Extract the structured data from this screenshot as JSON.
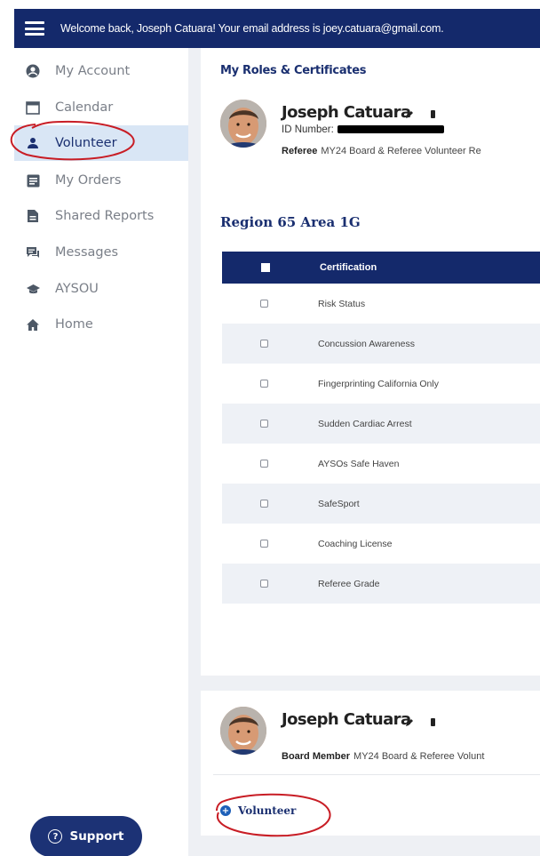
{
  "header": {
    "welcome_text": "Welcome back, Joseph Catuara! Your email address is joey.catuara@gmail.com."
  },
  "sidebar": {
    "items": [
      {
        "label": "My Account",
        "icon": "user-circle-icon"
      },
      {
        "label": "Calendar",
        "icon": "calendar-icon"
      },
      {
        "label": "Volunteer",
        "icon": "person-icon",
        "active": true
      },
      {
        "label": "My Orders",
        "icon": "orders-icon"
      },
      {
        "label": "Shared Reports",
        "icon": "report-icon"
      },
      {
        "label": "Messages",
        "icon": "messages-icon"
      },
      {
        "label": "AYSOU",
        "icon": "graduation-cap-icon"
      },
      {
        "label": "Home",
        "icon": "home-icon"
      }
    ],
    "support_label": "Support"
  },
  "main": {
    "section_title": "My Roles & Certificates",
    "profile1": {
      "name": "Joseph Catuara",
      "id_label": "ID Number:",
      "role": "Referee",
      "role_desc": "MY24 Board & Referee Volunteer Re"
    },
    "region_title": "Region 65 Area 1G",
    "table": {
      "header": "Certification",
      "rows": [
        "Risk Status",
        "Concussion Awareness",
        "Fingerprinting California Only",
        "Sudden Cardiac Arrest",
        "AYSOs Safe Haven",
        "SafeSport",
        "Coaching License",
        "Referee Grade"
      ]
    },
    "profile2": {
      "name": "Joseph Catuara",
      "role": "Board Member",
      "role_desc": "MY24 Board & Referee Volunt"
    },
    "volunteer_link": "Volunteer"
  },
  "colors": {
    "navy": "#14296b",
    "active_bg": "#d9e6f5",
    "annotation_red": "#c81d25"
  }
}
